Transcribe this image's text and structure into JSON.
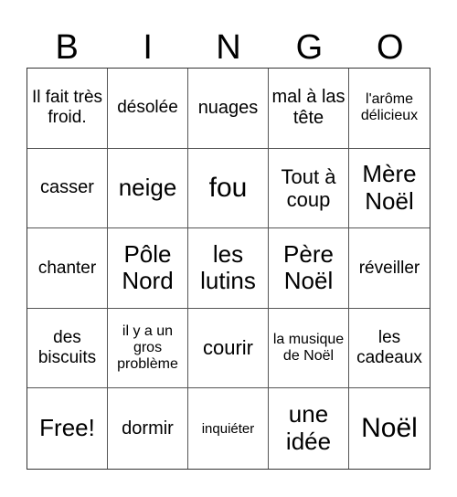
{
  "header": [
    "B",
    "I",
    "N",
    "G",
    "O"
  ],
  "cells": [
    {
      "text": "Il fait très froid.",
      "size": "s18"
    },
    {
      "text": "désolée",
      "size": "s18"
    },
    {
      "text": "nuages",
      "size": "s20"
    },
    {
      "text": "mal à las tête",
      "size": "s20"
    },
    {
      "text": "l'arôme délicieux",
      "size": "s16"
    },
    {
      "text": "casser",
      "size": "s20"
    },
    {
      "text": "neige",
      "size": "s26"
    },
    {
      "text": "fou",
      "size": "s30"
    },
    {
      "text": "Tout à coup",
      "size": "s22"
    },
    {
      "text": "Mère Noël",
      "size": "s26"
    },
    {
      "text": "chanter",
      "size": "s18"
    },
    {
      "text": "Pôle Nord",
      "size": "s26"
    },
    {
      "text": "les lutins",
      "size": "s26"
    },
    {
      "text": "Père Noël",
      "size": "s26"
    },
    {
      "text": "réveiller",
      "size": "s18"
    },
    {
      "text": "des biscuits",
      "size": "s18"
    },
    {
      "text": "il y a un gros problème",
      "size": "s16"
    },
    {
      "text": "courir",
      "size": "s22"
    },
    {
      "text": "la musique de Noël",
      "size": "s16"
    },
    {
      "text": "les cadeaux",
      "size": "s18"
    },
    {
      "text": "Free!",
      "size": "s26"
    },
    {
      "text": "dormir",
      "size": "s20"
    },
    {
      "text": "inquiéter",
      "size": "s14"
    },
    {
      "text": "une idée",
      "size": "s26"
    },
    {
      "text": "Noël",
      "size": "s30"
    }
  ]
}
